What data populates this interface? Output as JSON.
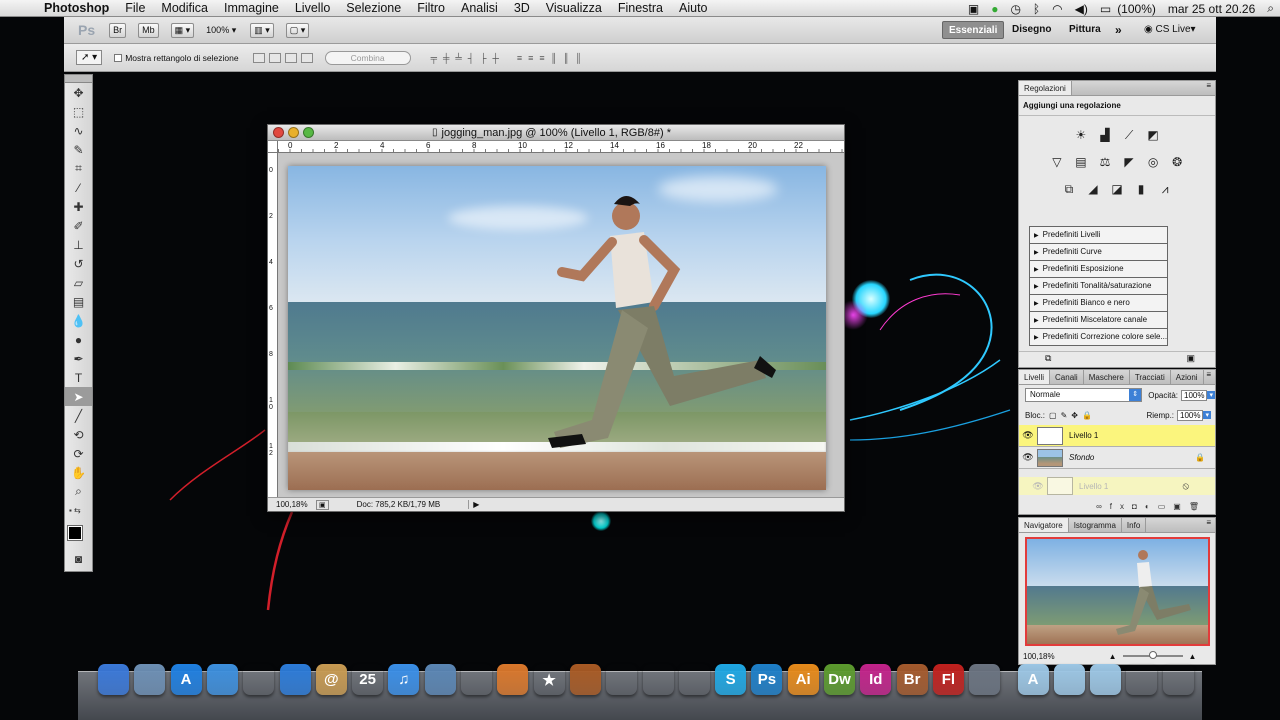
{
  "menubar": {
    "app_name": "Photoshop",
    "menus": [
      "File",
      "Modifica",
      "Immagine",
      "Livello",
      "Selezione",
      "Filtro",
      "Analisi",
      "3D",
      "Visualizza",
      "Finestra",
      "Aiuto"
    ],
    "battery": "(100%)",
    "datetime": "mar 25 ott  20.26"
  },
  "appbar": {
    "logo": "Ps",
    "bridge": "Br",
    "minibridge": "Mb",
    "zoom": "100%",
    "workspaces": {
      "essentials": "Essenziali",
      "design": "Disegno",
      "painting": "Pittura",
      "more": "»",
      "cslive": "CS Live"
    }
  },
  "options": {
    "auto_select_label": "Mostra rettangolo di selezione",
    "combine_button": "Combina"
  },
  "document": {
    "title": "jogging_man.jpg @ 100% (Livello 1, RGB/8#) *",
    "ruler_ticks": [
      "0",
      "2",
      "4",
      "6",
      "8",
      "10",
      "12",
      "14",
      "16",
      "18",
      "20",
      "22"
    ],
    "vruler_ticks": [
      "0",
      "2",
      "4",
      "6",
      "8",
      "1\n0",
      "1\n2"
    ],
    "zoom_status": "100,18%",
    "doc_info": "Doc: 785,2 KB/1,79 MB"
  },
  "adjustments": {
    "tab": "Regolazioni",
    "heading": "Aggiungi una regolazione",
    "presets": [
      "Predefiniti Livelli",
      "Predefiniti Curve",
      "Predefiniti Esposizione",
      "Predefiniti Tonalità/saturazione",
      "Predefiniti Bianco e nero",
      "Predefiniti Miscelatore canale",
      "Predefiniti Correzione colore sele..."
    ]
  },
  "layers": {
    "tabs": [
      "Livelli",
      "Canali",
      "Maschere",
      "Tracciati",
      "Azioni"
    ],
    "blend_mode": "Normale",
    "opacity_label": "Opacità:",
    "opacity": "100%",
    "lock_label": "Bloc.:",
    "fill_label": "Riemp.:",
    "fill": "100%",
    "items": [
      {
        "name": "Livello 1",
        "selected": true
      },
      {
        "name": "Sfondo",
        "selected": false
      }
    ],
    "drag_ghost": "Livello 1"
  },
  "navigator": {
    "tabs": [
      "Navigatore",
      "Istogramma",
      "Info"
    ],
    "zoom": "100,18%"
  },
  "dock": {
    "items": [
      {
        "name": "finder",
        "label": "",
        "color": "#3a78d8"
      },
      {
        "name": "preview",
        "label": "",
        "color": "#6d8fb4"
      },
      {
        "name": "app-store",
        "label": "A",
        "color": "#1f7fe0"
      },
      {
        "name": "safari",
        "label": "",
        "color": "#3d8fdd"
      },
      {
        "name": "dashboard",
        "label": "",
        "color": "#333"
      },
      {
        "name": "facetime",
        "label": "",
        "color": "#2c7bd8"
      },
      {
        "name": "address-book",
        "label": "@",
        "color": "#c79a52"
      },
      {
        "name": "ical",
        "label": "25",
        "color": "#e44"
      },
      {
        "name": "itunes",
        "label": "♫",
        "color": "#3a8ee6"
      },
      {
        "name": "iphoto",
        "label": "",
        "color": "#5b86b4"
      },
      {
        "name": "photo-booth",
        "label": "",
        "color": "#b11"
      },
      {
        "name": "image-capture",
        "label": "",
        "color": "#d9772b"
      },
      {
        "name": "imovie",
        "label": "★",
        "color": "#444"
      },
      {
        "name": "garageband",
        "label": "",
        "color": "#a85a24"
      },
      {
        "name": "system-preferences",
        "label": "",
        "color": "#777"
      },
      {
        "name": "textedit",
        "label": "",
        "color": "#ddd"
      },
      {
        "name": "calculator",
        "label": "",
        "color": "#ccc"
      },
      {
        "name": "skype",
        "label": "S",
        "color": "#1fa7e3"
      },
      {
        "name": "photoshop",
        "label": "Ps",
        "color": "#1e7fc8"
      },
      {
        "name": "illustrator",
        "label": "Ai",
        "color": "#e68a1b"
      },
      {
        "name": "dreamweaver",
        "label": "Dw",
        "color": "#5c9a2e"
      },
      {
        "name": "indesign",
        "label": "Id",
        "color": "#c2238a"
      },
      {
        "name": "bridge",
        "label": "Br",
        "color": "#a45a2d"
      },
      {
        "name": "flash",
        "label": "Fl",
        "color": "#c0211e"
      },
      {
        "name": "image-capture-2",
        "label": "",
        "color": "#6a7380"
      },
      {
        "name": "applications-folder",
        "label": "A",
        "color": "#9cc6e4"
      },
      {
        "name": "documents-folder",
        "label": "",
        "color": "#9cc6e4"
      },
      {
        "name": "downloads-folder",
        "label": "",
        "color": "#9cc6e4"
      },
      {
        "name": "stack-folder",
        "label": "",
        "color": "#ddd"
      },
      {
        "name": "trash",
        "label": "",
        "color": "#888"
      }
    ]
  }
}
